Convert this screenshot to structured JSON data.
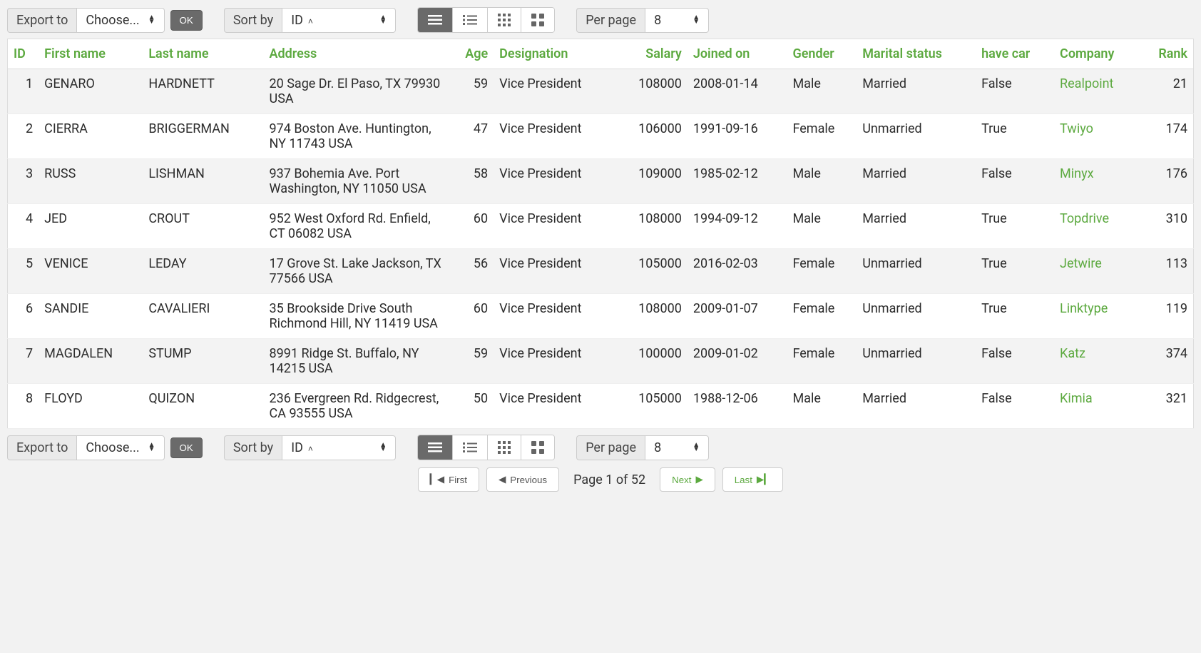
{
  "toolbar": {
    "export_label": "Export to",
    "choose_label": "Choose...",
    "ok_label": "OK",
    "sortby_label": "Sort by",
    "sort_value": "ID",
    "perpage_label": "Per page",
    "perpage_value": "8"
  },
  "table": {
    "headers": {
      "id": "ID",
      "first_name": "First name",
      "last_name": "Last name",
      "address": "Address",
      "age": "Age",
      "designation": "Designation",
      "salary": "Salary",
      "joined_on": "Joined on",
      "gender": "Gender",
      "marital_status": "Marital status",
      "have_car": "have car",
      "company": "Company",
      "rank": "Rank"
    },
    "rows": [
      {
        "id": "1",
        "first_name": "GENARO",
        "last_name": "HARDNETT",
        "address": "20 Sage Dr. El Paso, TX 79930 USA",
        "age": "59",
        "designation": "Vice President",
        "salary": "108000",
        "joined_on": "2008-01-14",
        "gender": "Male",
        "marital_status": "Married",
        "have_car": "False",
        "company": "Realpoint",
        "rank": "21"
      },
      {
        "id": "2",
        "first_name": "CIERRA",
        "last_name": "BRIGGERMAN",
        "address": "974 Boston Ave. Huntington, NY 11743 USA",
        "age": "47",
        "designation": "Vice President",
        "salary": "106000",
        "joined_on": "1991-09-16",
        "gender": "Female",
        "marital_status": "Unmarried",
        "have_car": "True",
        "company": "Twiyo",
        "rank": "174"
      },
      {
        "id": "3",
        "first_name": "RUSS",
        "last_name": "LISHMAN",
        "address": "937 Bohemia Ave. Port Washington, NY 11050 USA",
        "age": "58",
        "designation": "Vice President",
        "salary": "109000",
        "joined_on": "1985-02-12",
        "gender": "Male",
        "marital_status": "Married",
        "have_car": "False",
        "company": "Minyx",
        "rank": "176"
      },
      {
        "id": "4",
        "first_name": "JED",
        "last_name": "CROUT",
        "address": "952 West Oxford Rd. Enfield, CT 06082 USA",
        "age": "60",
        "designation": "Vice President",
        "salary": "108000",
        "joined_on": "1994-09-12",
        "gender": "Male",
        "marital_status": "Married",
        "have_car": "True",
        "company": "Topdrive",
        "rank": "310"
      },
      {
        "id": "5",
        "first_name": "VENICE",
        "last_name": "LEDAY",
        "address": "17 Grove St. Lake Jackson, TX 77566 USA",
        "age": "56",
        "designation": "Vice President",
        "salary": "105000",
        "joined_on": "2016-02-03",
        "gender": "Female",
        "marital_status": "Unmarried",
        "have_car": "True",
        "company": "Jetwire",
        "rank": "113"
      },
      {
        "id": "6",
        "first_name": "SANDIE",
        "last_name": "CAVALIERI",
        "address": "35 Brookside Drive South Richmond Hill, NY 11419 USA",
        "age": "60",
        "designation": "Vice President",
        "salary": "108000",
        "joined_on": "2009-01-07",
        "gender": "Female",
        "marital_status": "Unmarried",
        "have_car": "True",
        "company": "Linktype",
        "rank": "119"
      },
      {
        "id": "7",
        "first_name": "MAGDALEN",
        "last_name": "STUMP",
        "address": "8991 Ridge St. Buffalo, NY 14215 USA",
        "age": "59",
        "designation": "Vice President",
        "salary": "100000",
        "joined_on": "2009-01-02",
        "gender": "Female",
        "marital_status": "Unmarried",
        "have_car": "False",
        "company": "Katz",
        "rank": "374"
      },
      {
        "id": "8",
        "first_name": "FLOYD",
        "last_name": "QUIZON",
        "address": "236 Evergreen Rd. Ridgecrest, CA 93555 USA",
        "age": "50",
        "designation": "Vice President",
        "salary": "105000",
        "joined_on": "1988-12-06",
        "gender": "Male",
        "marital_status": "Married",
        "have_car": "False",
        "company": "Kimia",
        "rank": "321"
      }
    ]
  },
  "pagination": {
    "first": "First",
    "previous": "Previous",
    "page_info": "Page 1 of 52",
    "next": "Next",
    "last": "Last"
  }
}
